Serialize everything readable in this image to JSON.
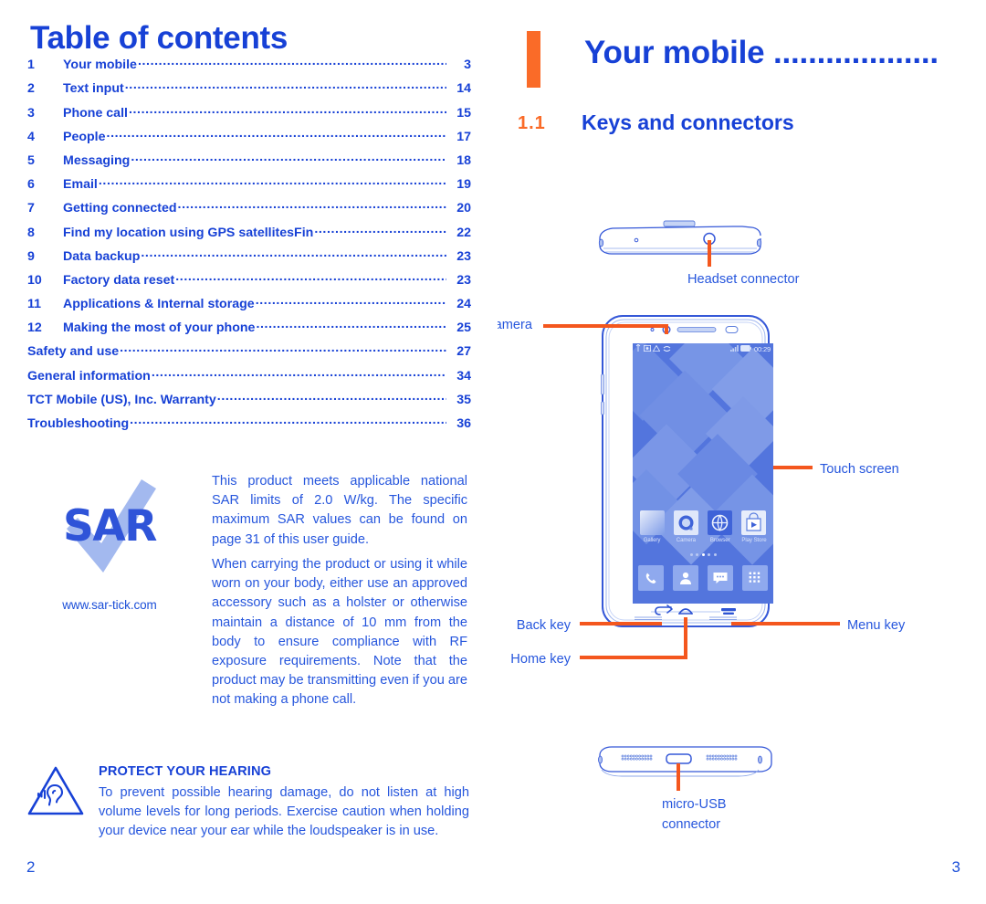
{
  "colors": {
    "blue": "#1741d6",
    "body_blue": "#2656dd",
    "orange": "#fa6b28",
    "sar_blue": "#2f54d8",
    "tick_blue": "#9fb6ec"
  },
  "left_page": {
    "title": "Table of contents",
    "toc": [
      {
        "num": "1",
        "label": "Your mobile",
        "page": "3"
      },
      {
        "num": "2",
        "label": "Text input",
        "page": "14"
      },
      {
        "num": "3",
        "label": "Phone call",
        "page": "15"
      },
      {
        "num": "4",
        "label": "People",
        "page": "17"
      },
      {
        "num": "5",
        "label": "Messaging",
        "page": "18"
      },
      {
        "num": "6",
        "label": "Email",
        "page": "19"
      },
      {
        "num": "7",
        "label": "Getting connected",
        "page": "20"
      },
      {
        "num": "8",
        "label": "Find my location using GPS satellitesFin",
        "page": "22"
      },
      {
        "num": "9",
        "label": "Data backup",
        "page": "23"
      },
      {
        "num": "10",
        "label": "Factory data reset",
        "page": "23"
      },
      {
        "num": "11",
        "label": "Applications & Internal storage",
        "page": "24"
      },
      {
        "num": "12",
        "label": "Making the most of your phone",
        "page": "25"
      },
      {
        "num": "",
        "label": "Safety and use",
        "page": "27"
      },
      {
        "num": "",
        "label": "General information",
        "page": "34"
      },
      {
        "num": "",
        "label": "TCT Mobile (US), Inc. Warranty",
        "page": "35"
      },
      {
        "num": "",
        "label": "Troubleshooting",
        "page": "36"
      }
    ],
    "sar": {
      "logo_text": "SAR",
      "url": "www.sar-tick.com",
      "paragraph_1": "This product meets applicable national SAR limits of 2.0 W/kg. The specific maximum SAR values can be found on page 31 of this user guide.",
      "paragraph_2": "When carrying the product or using it while worn on your body, either use an approved accessory such as a holster or otherwise maintain a distance of 10 mm from the body to ensure compliance with RF exposure requirements. Note that the product may be transmitting even if you are not making a phone call."
    },
    "hearing": {
      "title": "PROTECT YOUR HEARING",
      "body": "To prevent possible hearing damage, do not listen at high volume levels for long periods. Exercise caution when holding your device near your ear while the loudspeaker is in use."
    },
    "folio": "2"
  },
  "right_page": {
    "chapter_number": "1",
    "chapter_title": "Your mobile ...................",
    "section_number": "1.1",
    "section_title": "Keys and connectors",
    "callouts": {
      "headset_connector": "Headset connector",
      "front_camera": "Front camera",
      "touch_screen": "Touch screen",
      "back_key": "Back key",
      "home_key": "Home key",
      "menu_key": "Menu key",
      "micro_usb_line1": "micro-USB",
      "micro_usb_line2": "connector"
    },
    "phone_screen": {
      "clock": "00:29",
      "apps": [
        {
          "name": "Gallery"
        },
        {
          "name": "Camera"
        },
        {
          "name": "Browser"
        },
        {
          "name": "Play Store"
        }
      ],
      "dock": [
        "phone-icon",
        "contacts-icon",
        "messages-icon",
        "app-drawer-icon"
      ],
      "page_dots": 5,
      "active_dot": 2
    },
    "folio": "3"
  }
}
